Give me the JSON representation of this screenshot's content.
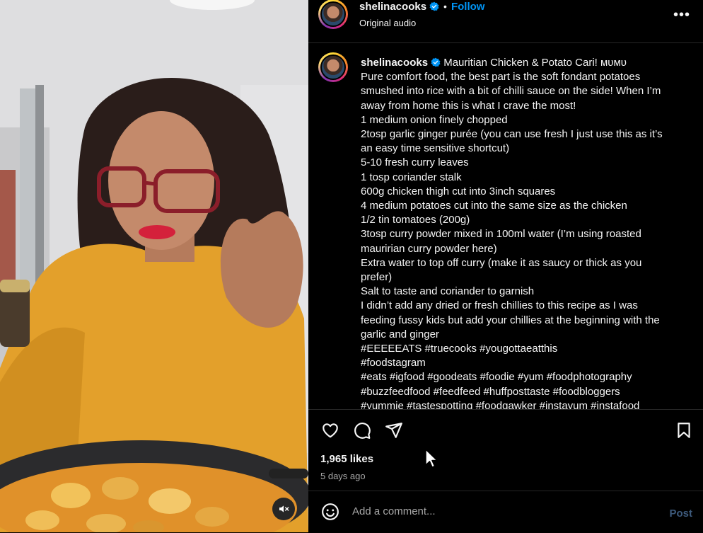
{
  "post_header": {
    "username": "shelinacooks",
    "separator": "•",
    "follow_label": "Follow",
    "audio_label": "Original audio",
    "more_label": "•••"
  },
  "caption": {
    "username": "shelinacooks",
    "lines": [
      "Mauritian Chicken & Potato Cari! ᴍᴜᴍᴜ",
      "Pure comfort food, the best part is the soft fondant potatoes",
      "smushed into rice with a bit of chilli sauce on the side! When I’m",
      "away from home this is what I crave the most!",
      "1 medium onion finely chopped",
      "2tosp garlic ginger purée (you can use fresh I just use this as it’s",
      "an easy time sensitive shortcut)",
      "5-10 fresh curry leaves",
      "1 tosp coriander stalk",
      "600g chicken thigh cut into 3inch squares",
      "4 medium potatoes cut into the same size as the chicken",
      "1/2 tin tomatoes (200g)",
      "3tosp curry powder mixed in 100ml water (I’m using roasted",
      "mauririan curry powder here)",
      "Extra water to top off curry (make it as saucy or thick as you",
      "prefer)",
      "Salt to taste and coriander to garnish",
      "I didn’t add any dried or fresh chillies to this recipe as I was",
      "feeding fussy kids but add your chillies at the beginning with the",
      "garlic and ginger",
      "#EEEEEATS #truecooks #yougottaeatthis",
      "#foodstagram",
      "#eats #igfood #goodeats #foodie #yum #foodphotography",
      "#buzzfeedfood #feedfeed #huffposttaste #foodbloggers",
      "#yummie #tastespotting #foodgawker #instayum #instafood"
    ]
  },
  "engagement": {
    "likes": "1,965 likes",
    "date": "5 days ago"
  },
  "comment": {
    "placeholder": "Add a comment...",
    "post_label": "Post"
  },
  "colors": {
    "accent": "#0095f6",
    "muted_text": "#a8a8a8",
    "divider": "#262626",
    "post_disabled": "#3d5a7c"
  },
  "icons": {
    "verified": "verified-badge-icon",
    "like": "heart-icon",
    "comment": "comment-bubble-icon",
    "share": "paper-plane-icon",
    "save": "bookmark-icon",
    "emoji": "smiley-icon",
    "mute": "speaker-muted-icon"
  }
}
